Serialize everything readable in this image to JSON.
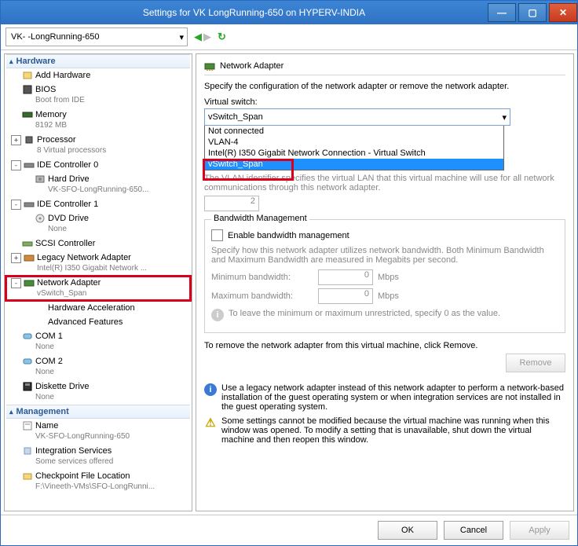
{
  "title": "Settings for VK        LongRunning-650 on HYPERV-INDIA",
  "vm_selector": "VK-      -LongRunning-650",
  "tree": {
    "hardware_label": "Hardware",
    "management_label": "Management",
    "items": [
      {
        "label": "Add Hardware"
      },
      {
        "label": "BIOS",
        "sub": "Boot from IDE"
      },
      {
        "label": "Memory",
        "sub": "8192 MB"
      },
      {
        "label": "Processor",
        "sub": "8 Virtual processors",
        "exp": "+"
      },
      {
        "label": "IDE Controller 0",
        "exp": "-",
        "children": [
          {
            "label": "Hard Drive",
            "sub": "VK-SFO-LongRunning-650..."
          }
        ]
      },
      {
        "label": "IDE Controller 1",
        "exp": "-",
        "children": [
          {
            "label": "DVD Drive",
            "sub": "None"
          }
        ]
      },
      {
        "label": "SCSI Controller"
      },
      {
        "label": "Legacy Network Adapter",
        "sub": "Intel(R) I350 Gigabit Network ...",
        "exp": "+"
      },
      {
        "label": "Network Adapter",
        "sub": "vSwitch_Span",
        "exp": "-",
        "hl": true,
        "children": [
          {
            "label": "Hardware Acceleration"
          },
          {
            "label": "Advanced Features"
          }
        ]
      },
      {
        "label": "COM 1",
        "sub": "None"
      },
      {
        "label": "COM 2",
        "sub": "None"
      },
      {
        "label": "Diskette Drive",
        "sub": "None"
      }
    ],
    "mgmt": [
      {
        "label": "Name",
        "sub": "VK-SFO-LongRunning-650"
      },
      {
        "label": "Integration Services",
        "sub": "Some services offered"
      },
      {
        "label": "Checkpoint File Location",
        "sub": "F:\\Vineeth-VMs\\SFO-LongRunni..."
      }
    ]
  },
  "panel": {
    "heading": "Network Adapter",
    "desc": "Specify the configuration of the network adapter or remove the network adapter.",
    "vs_label": "Virtual switch:",
    "vs_value": "vSwitch_Span",
    "vs_options": [
      "Not connected",
      "VLAN-4",
      "Intel(R) I350 Gigabit Network Connection - Virtual Switch",
      "vSwitch_Span"
    ],
    "vlan_note": "The VLAN identifier specifies the virtual LAN that this virtual machine will use for all network communications through this network adapter.",
    "vlan_value": "2",
    "bw_legend": "Bandwidth Management",
    "bw_enable": "Enable bandwidth management",
    "bw_desc": "Specify how this network adapter utilizes network bandwidth. Both Minimum Bandwidth and Maximum Bandwidth are measured in Megabits per second.",
    "min_label": "Minimum bandwidth:",
    "min_val": "0",
    "max_label": "Maximum bandwidth:",
    "max_val": "0",
    "mbps": "Mbps",
    "bw_note": "To leave the minimum or maximum unrestricted, specify 0 as the value.",
    "remove_desc": "To remove the network adapter from this virtual machine, click Remove.",
    "remove_btn": "Remove",
    "info1": "Use a legacy network adapter instead of this network adapter to perform a network-based installation of the guest operating system or when integration services are not installed in the guest operating system.",
    "info2": "Some settings cannot be modified because the virtual machine was running when this window was opened. To modify a setting that is unavailable, shut down the virtual machine and then reopen this window."
  },
  "buttons": {
    "ok": "OK",
    "cancel": "Cancel",
    "apply": "Apply"
  }
}
